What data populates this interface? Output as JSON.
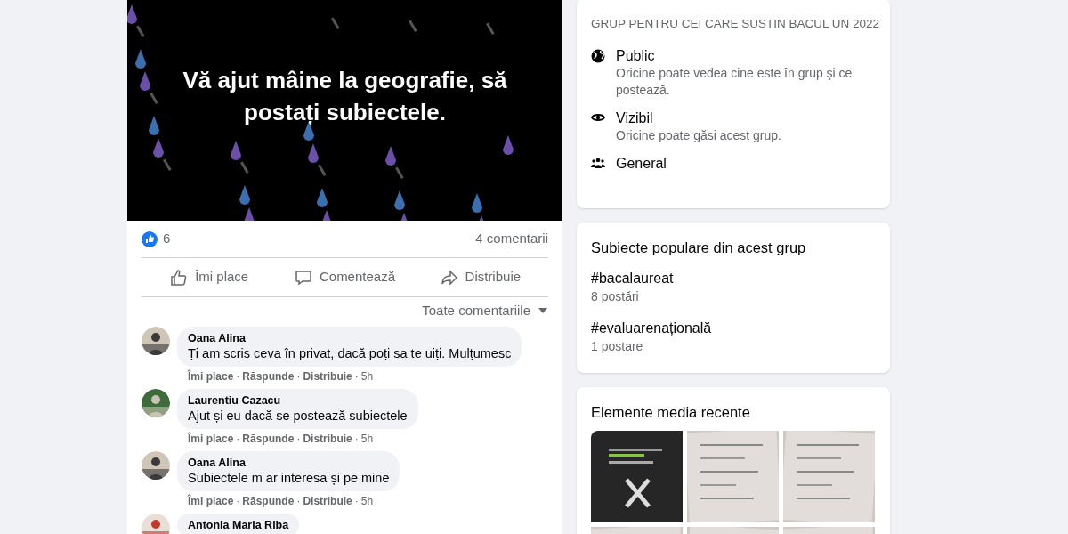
{
  "post": {
    "text": "Vă ajut mâine la geografie, să postați subiectele.",
    "reactions": "6",
    "comments_count": "4 comentarii",
    "actions": [
      {
        "kind": "like",
        "label": "Îmi place"
      },
      {
        "kind": "comment",
        "label": "Comentează"
      },
      {
        "kind": "share",
        "label": "Distribuie"
      }
    ],
    "filter": "Toate comentariile",
    "separator": "·",
    "comments": [
      {
        "author": "Oana Alina",
        "text": "Ți am scris ceva în privat, dacă poți sa te uiți. Mulțumesc",
        "actions": [
          "Îmi place",
          "Răspunde",
          "Distribuie"
        ],
        "time": "5h"
      },
      {
        "author": "Laurentiu Cazacu",
        "text": "Ajut și eu dacă se postează subiectele",
        "actions": [
          "Îmi place",
          "Răspunde",
          "Distribuie"
        ],
        "time": "5h"
      },
      {
        "author": "Oana Alina",
        "text": "Subiectele m ar interesa și pe mine",
        "actions": [
          "Îmi place",
          "Răspunde",
          "Distribuie"
        ],
        "time": "5h"
      },
      {
        "author": "Antonia Maria Riba"
      }
    ]
  },
  "about": {
    "title": "GRUP PENTRU CEI CARE SUSTIN BACUL UN 2022",
    "items": [
      {
        "kind": "globe",
        "label": "Public",
        "description": "Oricine poate vedea cine este în grup şi ce postează."
      },
      {
        "kind": "eye",
        "label": "Vizibil",
        "description": "Oricine poate găsi acest grup."
      },
      {
        "kind": "people",
        "label": "General"
      }
    ]
  },
  "topics": {
    "title": "Subiecte populare din acest grup",
    "items": [
      {
        "tag": "#bacalaureat",
        "count": "8 postări"
      },
      {
        "tag": "#evaluarenațională",
        "count": "1 postare"
      }
    ]
  },
  "media": {
    "title": "Elemente media recente"
  }
}
